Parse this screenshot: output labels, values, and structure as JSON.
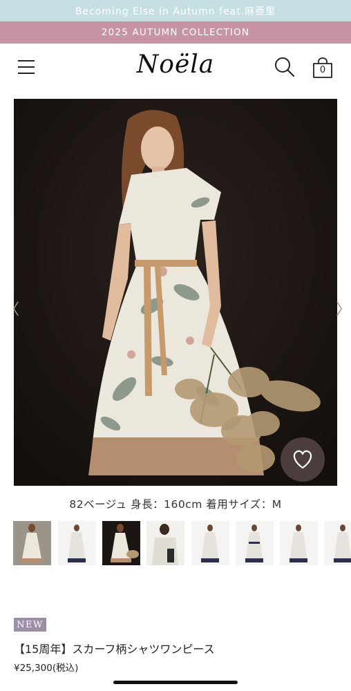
{
  "top_banner": {
    "text": "Becoming Else in Autumn feat.麻亜里"
  },
  "collection_banner": {
    "text": "2025 AUTUMN COLLECTION"
  },
  "header": {
    "logo": "Noëla",
    "cart_count": "0"
  },
  "colors": {
    "banner1": "#c6dfe3",
    "banner2": "#c794a3",
    "badge": "#9d8fa8"
  },
  "carousel": {
    "prev_icon": "〈",
    "next_icon": "〉"
  },
  "caption": "82ベージュ 身長：160cm 着用サイズ：M",
  "product": {
    "badge": "NEW",
    "title": "【15周年】スカーフ柄シャツワンピース",
    "price": "¥25,300(税込)"
  }
}
